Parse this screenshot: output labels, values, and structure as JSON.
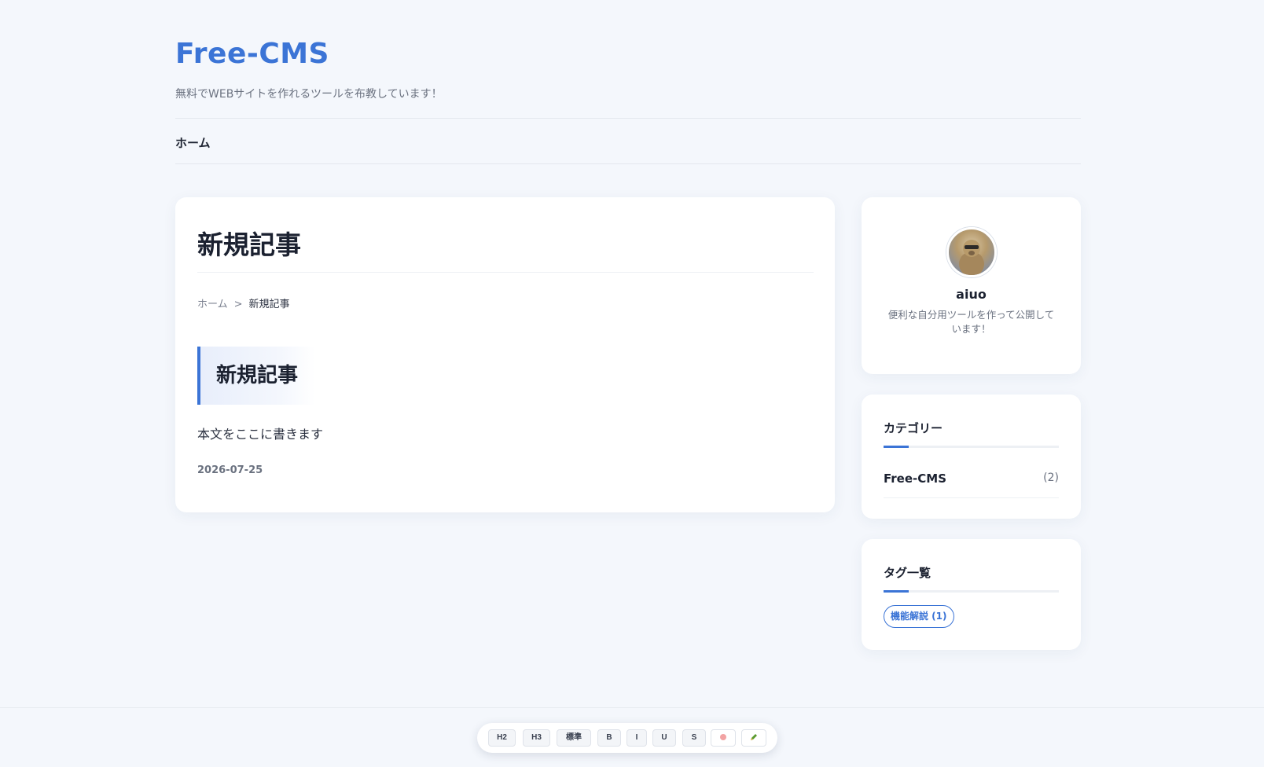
{
  "site": {
    "title": "Free-CMS",
    "description": "無料でWEBサイトを作れるツールを布教しています！"
  },
  "nav": {
    "items": [
      {
        "label": "ホーム"
      }
    ]
  },
  "article": {
    "title": "新規記事",
    "breadcrumb": {
      "home": "ホーム",
      "separator": ">",
      "current": "新規記事"
    },
    "heading": "新規記事",
    "body": "本文をここに書きます",
    "date": "2026-07-25"
  },
  "profile": {
    "name": "aiuo",
    "bio": "便利な自分用ツールを作って公開しています！"
  },
  "categories": {
    "title": "カテゴリー",
    "items": [
      {
        "name": "Free-CMS",
        "count": "(2)"
      }
    ]
  },
  "tags": {
    "title": "タグ一覧",
    "items": [
      {
        "label": "機能解説 (1)"
      }
    ]
  },
  "editor_toolbar": {
    "buttons": [
      "H2",
      "H3",
      "標準",
      "B",
      "I",
      "U",
      "S"
    ],
    "marker_icon": "highlight-marker-icon",
    "pen_icon": "text-color-pen-icon"
  },
  "colors": {
    "accent": "#3b74d6",
    "background": "#f4f7fc"
  }
}
